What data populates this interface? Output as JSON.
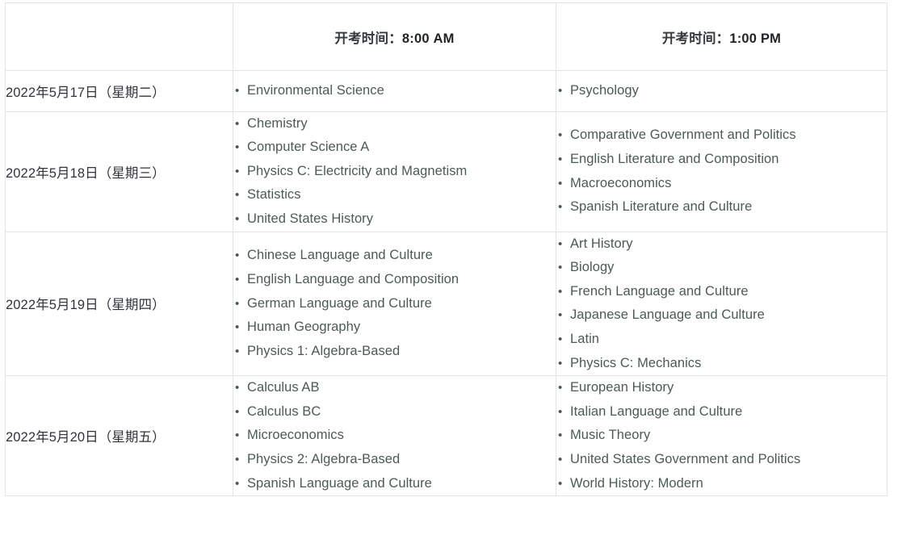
{
  "table": {
    "columns": [
      {
        "key": "date",
        "header": ""
      },
      {
        "key": "am",
        "header_cn": "开考时间：",
        "header_time": "8:00 AM"
      },
      {
        "key": "pm",
        "header_cn": "开考时间：",
        "header_time": "1:00 PM"
      }
    ],
    "bullet": "•",
    "colors": {
      "border": "#e3e4e6",
      "date_text": "#30343a",
      "header_text": "#2f3336",
      "subject_text": "#4c5a56",
      "background": "#ffffff"
    },
    "rows": [
      {
        "date": "2022年5月17日（星期二）",
        "am": [
          "Environmental Science"
        ],
        "pm": [
          "Psychology"
        ]
      },
      {
        "date": "2022年5月18日（星期三）",
        "am": [
          "Chemistry",
          "Computer Science A",
          "Physics C: Electricity and Magnetism",
          "Statistics",
          "United States History"
        ],
        "pm": [
          "Comparative Government and Politics",
          "English Literature and Composition",
          "Macroeconomics",
          "Spanish Literature and Culture"
        ]
      },
      {
        "date": "2022年5月19日（星期四）",
        "am": [
          "Chinese Language and Culture",
          "English Language and Composition",
          "German Language and Culture",
          "Human Geography",
          "Physics 1: Algebra-Based"
        ],
        "pm": [
          "Art History",
          "Biology",
          "French Language and Culture",
          "Japanese Language and Culture",
          "Latin",
          "Physics C: Mechanics"
        ]
      },
      {
        "date": "2022年5月20日（星期五）",
        "am": [
          "Calculus AB",
          "Calculus BC",
          "Microeconomics",
          "Physics 2: Algebra-Based",
          "Spanish Language and Culture"
        ],
        "pm": [
          "European History",
          "Italian Language and Culture",
          "Music Theory",
          "United States Government and Politics",
          "World History: Modern"
        ]
      }
    ]
  }
}
